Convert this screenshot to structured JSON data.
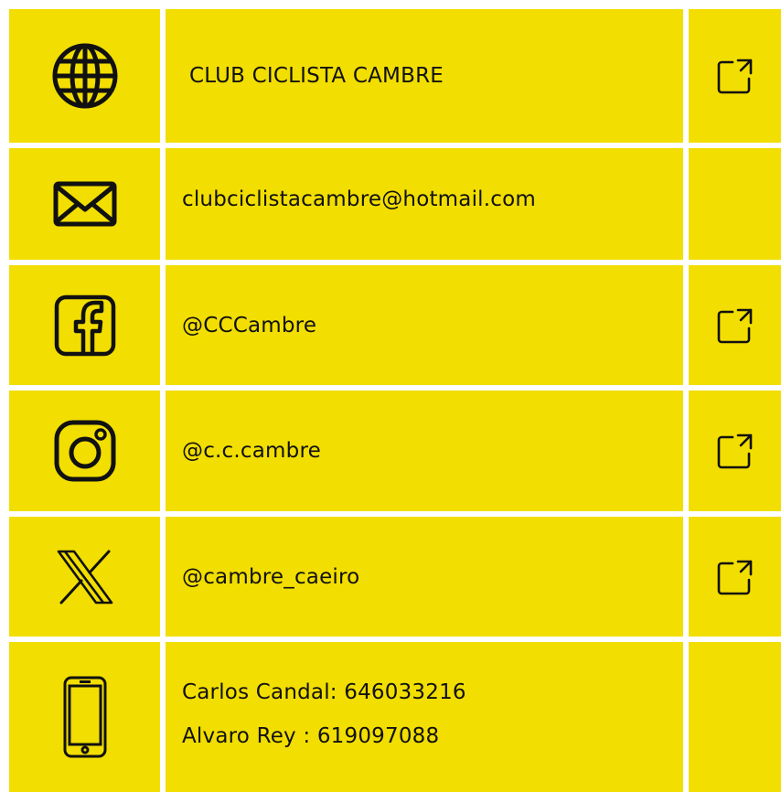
{
  "rows": [
    {
      "icon": "globe-icon",
      "text": "CLUB CICLISTA CAMBRE",
      "has_link": true
    },
    {
      "icon": "envelope-icon",
      "text": "clubciclistacambre@hotmail.com",
      "has_link": false
    },
    {
      "icon": "facebook-icon",
      "text": "@CCCambre",
      "has_link": true
    },
    {
      "icon": "instagram-icon",
      "text": "@c.c.cambre",
      "has_link": true
    },
    {
      "icon": "x-logo-icon",
      "text": "@cambre_caeiro",
      "has_link": true
    },
    {
      "icon": "smartphone-icon",
      "lines": [
        "Carlos Candal: 646033216",
        "Alvaro Rey : 619097088"
      ],
      "has_link": false
    }
  ],
  "colors": {
    "background": "#f2de00",
    "divider": "#ffffff",
    "ink": "#111111"
  },
  "action_icon": "external-link-icon"
}
